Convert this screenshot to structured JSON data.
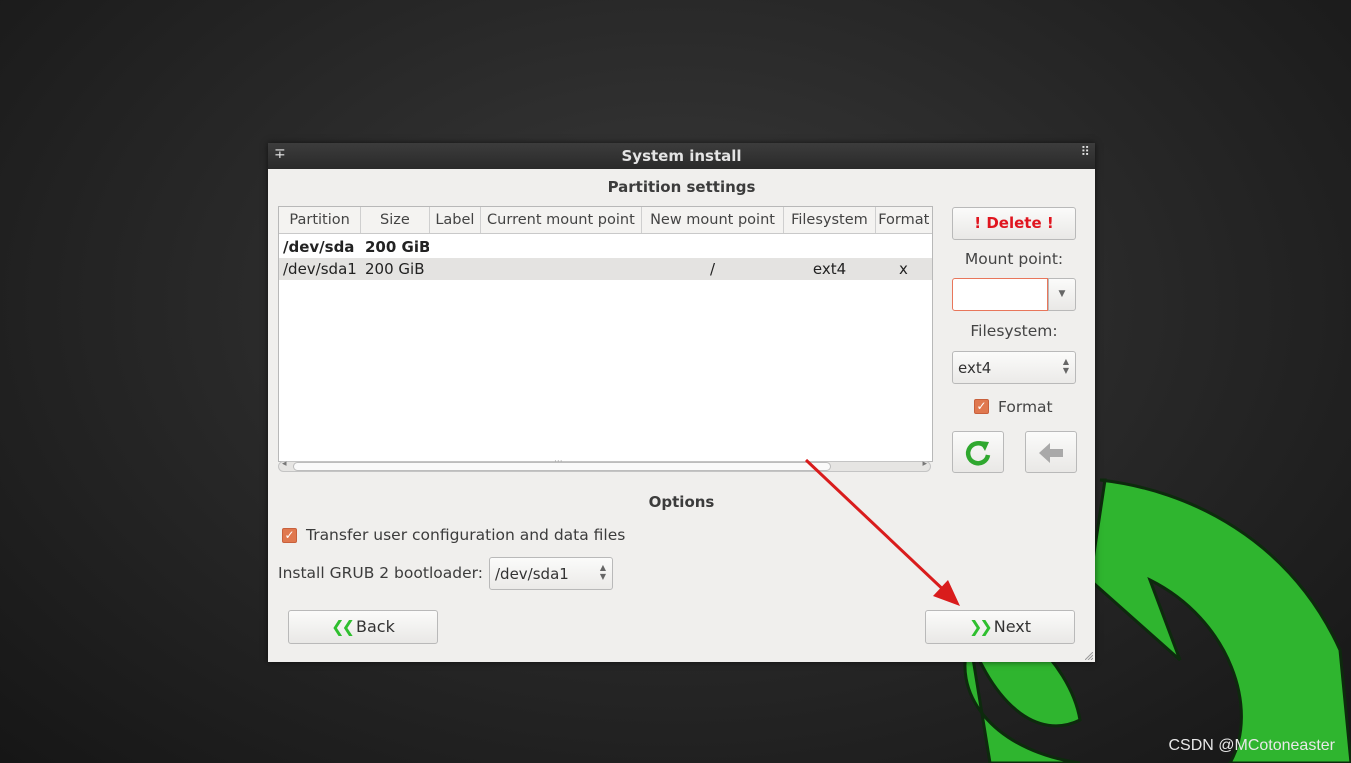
{
  "window": {
    "title": "System install",
    "left_icon": "∓",
    "right_icon": "⠿"
  },
  "partition_settings": {
    "title": "Partition settings",
    "columns": [
      "Partition",
      "Size",
      "Label",
      "Current mount point",
      "New mount point",
      "Filesystem",
      "Format"
    ],
    "rows": [
      {
        "partition": "/dev/sda",
        "size": "200 GiB",
        "label": "",
        "current_mount": "",
        "new_mount": "",
        "filesystem": "",
        "format": ""
      },
      {
        "partition": "/dev/sda1",
        "size": "200 GiB",
        "label": "",
        "current_mount": "",
        "new_mount": "/",
        "filesystem": "ext4",
        "format": "x"
      }
    ],
    "scrollbar_grip": "···"
  },
  "side_panel": {
    "delete_label": "! Delete !",
    "mount_point_label": "Mount point:",
    "mount_point_value": "",
    "filesystem_label": "Filesystem:",
    "filesystem_value": "ext4",
    "format_label": "Format",
    "format_checked": true
  },
  "options": {
    "title": "Options",
    "transfer_label": "Transfer user configuration and data files",
    "transfer_checked": true,
    "grub_label": "Install GRUB 2 bootloader:",
    "grub_value": "/dev/sda1"
  },
  "nav": {
    "back_label": "Back",
    "next_label": "Next"
  },
  "watermark": "CSDN @MCotoneaster",
  "colors": {
    "accent_orange": "#e0784f",
    "delete_red": "#e0151f",
    "chevron_green": "#2fbf2f",
    "annotation_arrow": "#d91c1c"
  }
}
